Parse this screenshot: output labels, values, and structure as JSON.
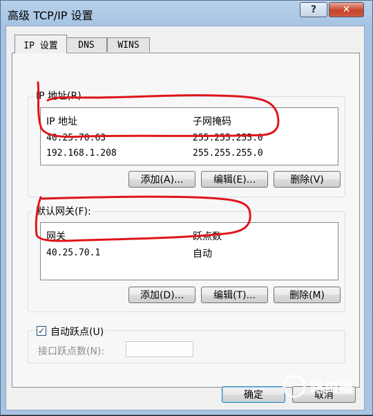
{
  "window": {
    "title": "高级 TCP/IP 设置",
    "help_label": "?",
    "close_label": "✕"
  },
  "tabs": [
    {
      "label": "IP 设置",
      "active": true
    },
    {
      "label": "DNS",
      "active": false
    },
    {
      "label": "WINS",
      "active": false
    }
  ],
  "ip_section": {
    "group_label": "IP 地址(R)",
    "col_ip": "IP 地址",
    "col_mask": "子网掩码",
    "rows": [
      {
        "ip": "40.25.70.63",
        "mask": "255.255.255.0"
      },
      {
        "ip": "192.168.1.208",
        "mask": "255.255.255.0"
      }
    ],
    "add": "添加(A)...",
    "edit": "编辑(E)...",
    "delete": "删除(V)"
  },
  "gateway_section": {
    "group_label": "默认网关(F):",
    "col_gateway": "网关",
    "col_metric": "跃点数",
    "rows": [
      {
        "gateway": "40.25.70.1",
        "metric": "自动"
      }
    ],
    "add": "添加(D)...",
    "edit": "编辑(T)...",
    "delete": "删除(M)"
  },
  "metric_section": {
    "auto_metric_label": "自动跃点(U)",
    "auto_metric_checked": true,
    "check_glyph": "✓",
    "interface_metric_label": "接口跃点数(N):",
    "interface_metric_value": ""
  },
  "footer": {
    "ok": "确定",
    "cancel": "取消"
  },
  "watermark": {
    "text": "路由器"
  },
  "colors": {
    "annotation_red": "#e0141b",
    "title_gradient": "#a9c4e2"
  }
}
